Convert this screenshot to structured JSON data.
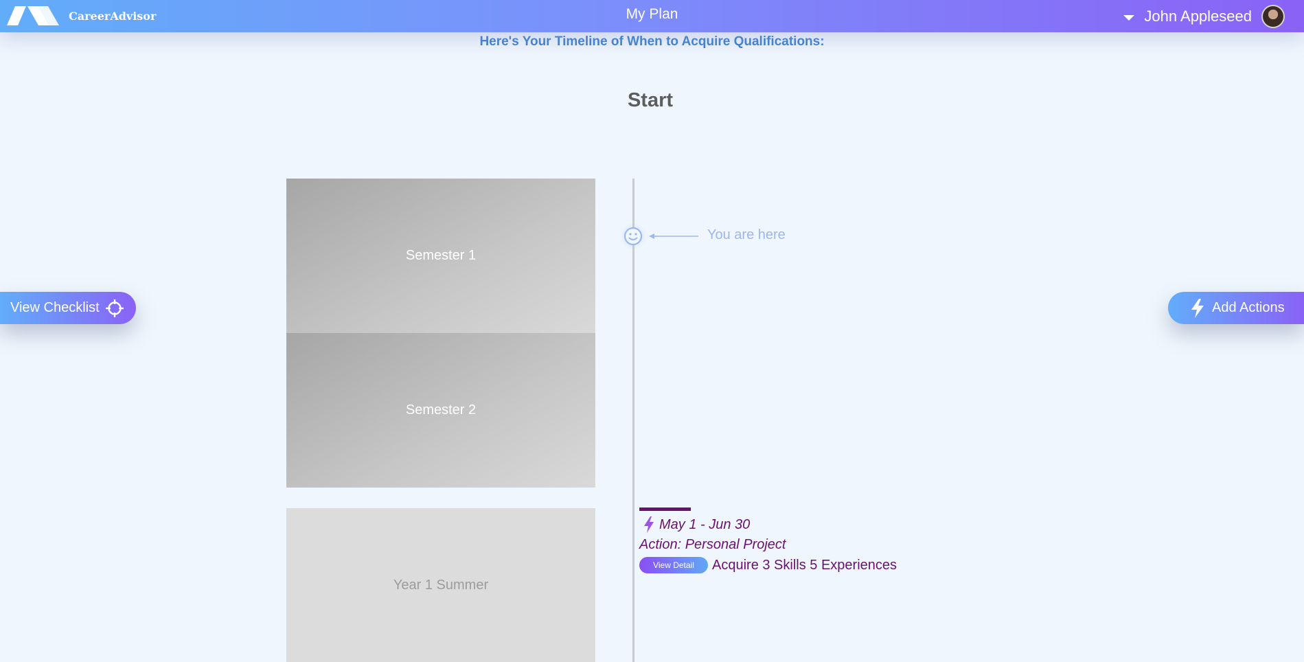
{
  "header": {
    "brand": "CareerAdvisor",
    "title": "My Plan",
    "user_name": "John Appleseed"
  },
  "headline": "Here's Your Timeline of When to Acquire Qualifications:",
  "timeline": {
    "start_label": "Start",
    "periods": [
      {
        "label": "Semester 1",
        "status": "current"
      },
      {
        "label": "Semester 2",
        "status": "upcoming"
      },
      {
        "label": "Year 1 Summer",
        "status": "later"
      }
    ],
    "you_are_here": "You are here"
  },
  "buttons": {
    "view_checklist": "View Checklist",
    "add_actions": "Add Actions"
  },
  "action": {
    "date_range": "May 1 - Jun 30",
    "name": "Action: Personal Project",
    "detail_button": "View Detail",
    "summary": "Acquire 3 Skills 5 Experiences"
  },
  "colors": {
    "header_gradient_start": "#62adfa",
    "header_gradient_end": "#8a62f6",
    "headline": "#3d7fcf",
    "action_text": "#6a1170",
    "you_are_here": "#9db6ec"
  },
  "icons": {
    "logo": "career-advisor-logo",
    "checklist": "crosshair-icon",
    "add_actions": "lightning-bolt-icon",
    "current_position": "smiley-icon"
  }
}
